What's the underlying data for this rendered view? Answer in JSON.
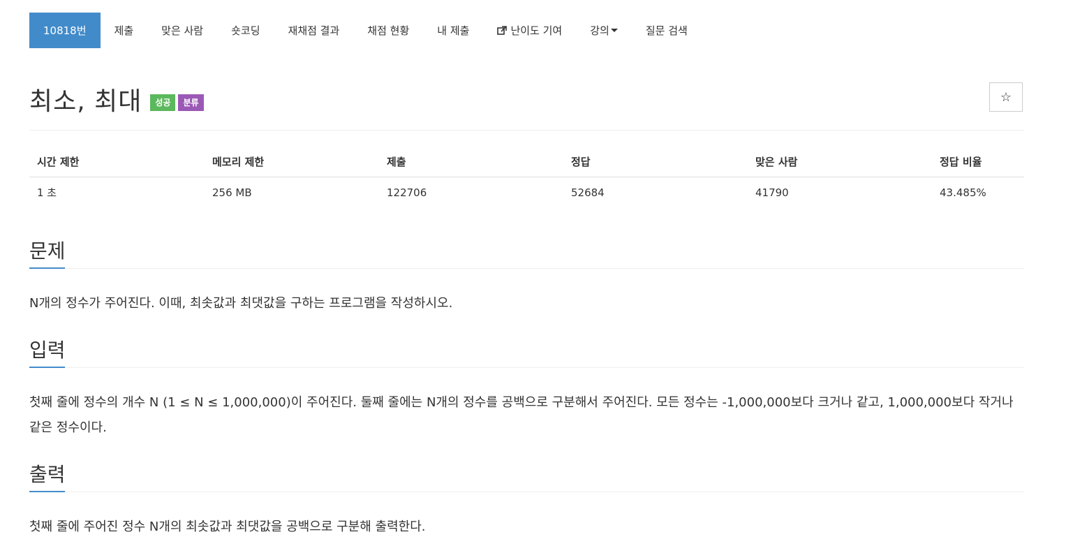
{
  "tabs": [
    {
      "label": "10818번",
      "active": true
    },
    {
      "label": "제출"
    },
    {
      "label": "맞은 사람"
    },
    {
      "label": "숏코딩"
    },
    {
      "label": "재채점 결과"
    },
    {
      "label": "채점 현황"
    },
    {
      "label": "내 제출"
    },
    {
      "label": "난이도 기여",
      "icon": "external-link-icon"
    },
    {
      "label": "강의",
      "icon": "caret-down-icon"
    },
    {
      "label": "질문 검색"
    }
  ],
  "problem": {
    "title": "최소, 최대",
    "badge_status": "성공",
    "badge_category": "분류",
    "star_icon": "☆"
  },
  "info_table": {
    "headers": [
      "시간 제한",
      "메모리 제한",
      "제출",
      "정답",
      "맞은 사람",
      "정답 비율"
    ],
    "values": [
      "1 초",
      "256 MB",
      "122706",
      "52684",
      "41790",
      "43.485%"
    ]
  },
  "sections": {
    "description": {
      "title": "문제",
      "text": "N개의 정수가 주어진다. 이때, 최솟값과 최댓값을 구하는 프로그램을 작성하시오."
    },
    "input": {
      "title": "입력",
      "text": "첫째 줄에 정수의 개수 N (1 ≤ N ≤ 1,000,000)이 주어진다. 둘째 줄에는 N개의 정수를 공백으로 구분해서 주어진다. 모든 정수는 -1,000,000보다 크거나 같고, 1,000,000보다 작거나 같은 정수이다."
    },
    "output": {
      "title": "출력",
      "text": "첫째 줄에 주어진 정수 N개의 최솟값과 최댓값을 공백으로 구분해 출력한다."
    }
  },
  "colors": {
    "accent": "#428bca",
    "success": "#5cb85c",
    "category": "#9b59b6"
  }
}
